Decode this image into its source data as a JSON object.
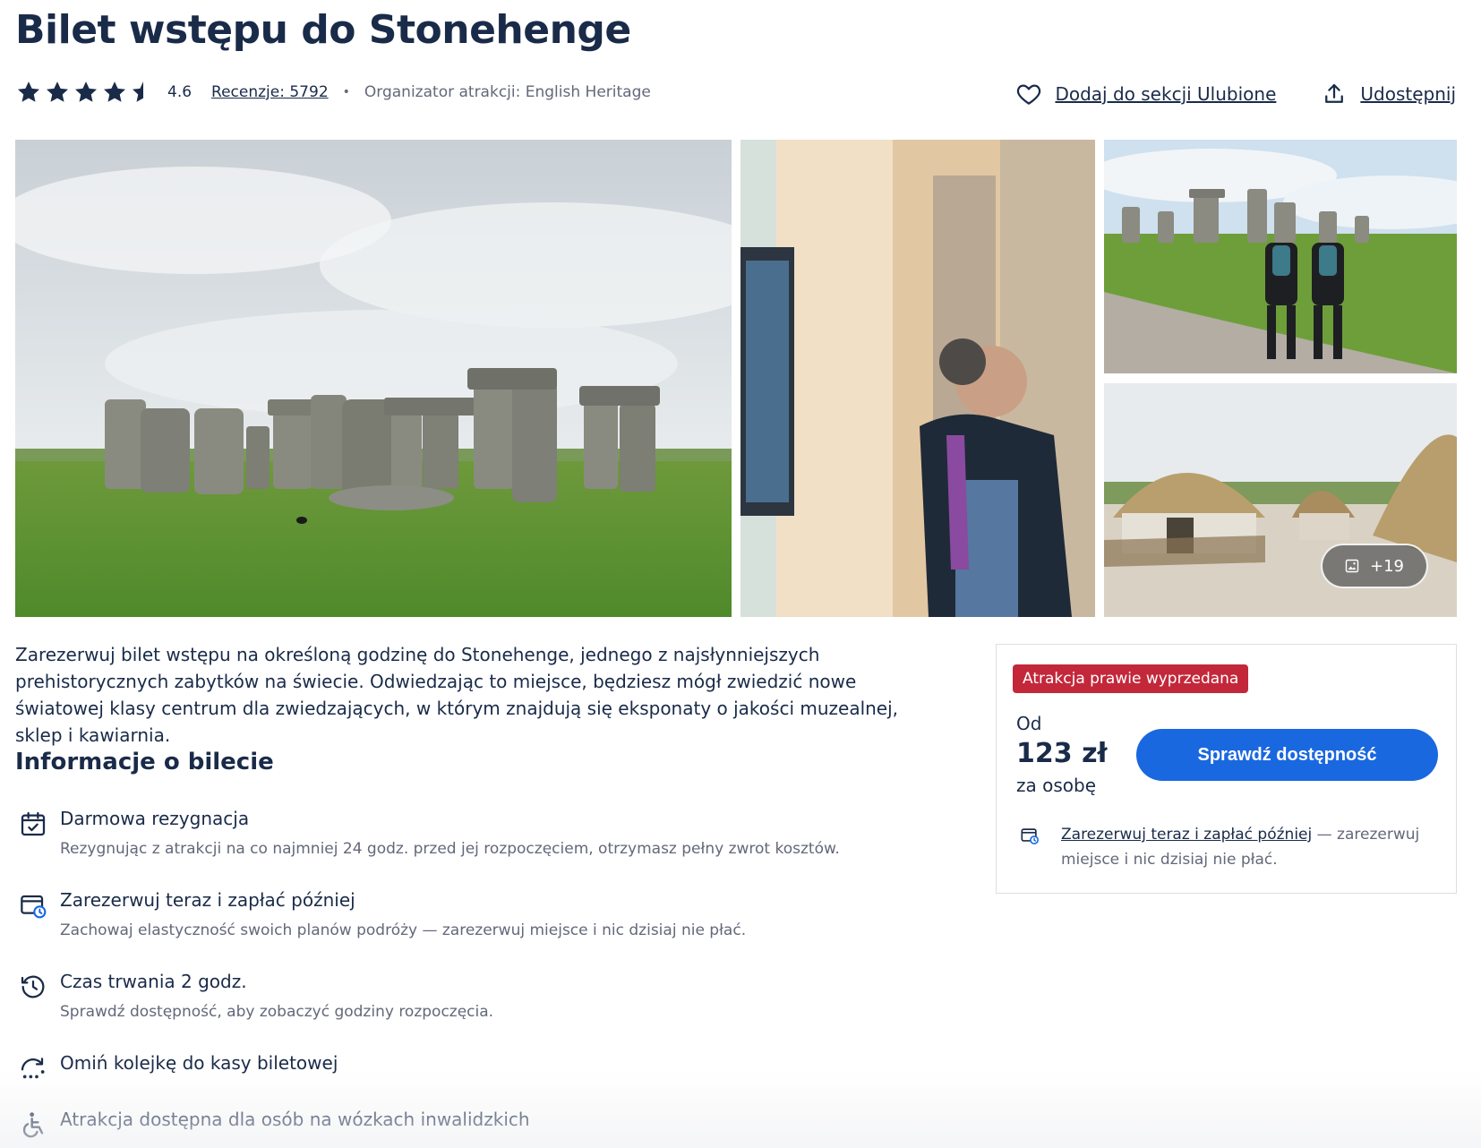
{
  "page": {
    "title": "Bilet wstępu do Stonehenge"
  },
  "rating": {
    "value": "4.6",
    "stars": 4.6,
    "reviews_label": "Recenzje: 5792",
    "organizer": "Organizator atrakcji: English Heritage"
  },
  "actions": {
    "favorite_label": "Dodaj do sekcji Ulubione",
    "share_label": "Udostępnij"
  },
  "gallery": {
    "more_label": "+19"
  },
  "description": "Zarezerwuj bilet wstępu na określoną godzinę do Stonehenge, jednego z najsłynniejszych prehistorycznych zabytków na świecie. Odwiedzając to miejsce, będziesz mógł zwiedzić nowe światowej klasy centrum dla zwiedzających, w którym znajdują się eksponaty o jakości muzealnej, sklep i kawiarnia.",
  "ticket_info": {
    "heading": "Informacje o bilecie",
    "items": [
      {
        "icon": "calendar-check-icon",
        "title": "Darmowa rezygnacja",
        "subtitle": "Rezygnując z atrakcji na co najmniej 24 godz. przed jej rozpoczęciem, otrzymasz pełny zwrot kosztów."
      },
      {
        "icon": "calendar-clock-icon",
        "title": "Zarezerwuj teraz i zapłać później",
        "subtitle": "Zachowaj elastyczność swoich planów podróży — zarezerwuj miejsce i nic dzisiaj nie płać."
      },
      {
        "icon": "history-clock-icon",
        "title": "Czas trwania 2 godz.",
        "subtitle": "Sprawdź dostępność, aby zobaczyć godziny rozpoczęcia."
      },
      {
        "icon": "skip-line-icon",
        "title": "Omiń kolejkę do kasy biletowej",
        "subtitle": ""
      },
      {
        "icon": "wheelchair-icon",
        "title": "Atrakcja dostępna dla osób na wózkach inwalidzkich",
        "subtitle": ""
      }
    ]
  },
  "booking": {
    "badge": "Atrakcja prawie wyprzedana",
    "from_label": "Od",
    "price": "123 zł",
    "per_label": "za osobę",
    "cta_label": "Sprawdź dostępność",
    "reserve_link": "Zarezerwuj teraz i zapłać później",
    "reserve_text": " — zarezerwuj miejsce i nic dzisiaj nie płać."
  },
  "colors": {
    "primary": "#1a68e0",
    "text": "#1a2b49",
    "muted": "#63687a",
    "badge": "#c3283a",
    "star": "#1a2b49",
    "icon_accent": "#1a68e0"
  }
}
